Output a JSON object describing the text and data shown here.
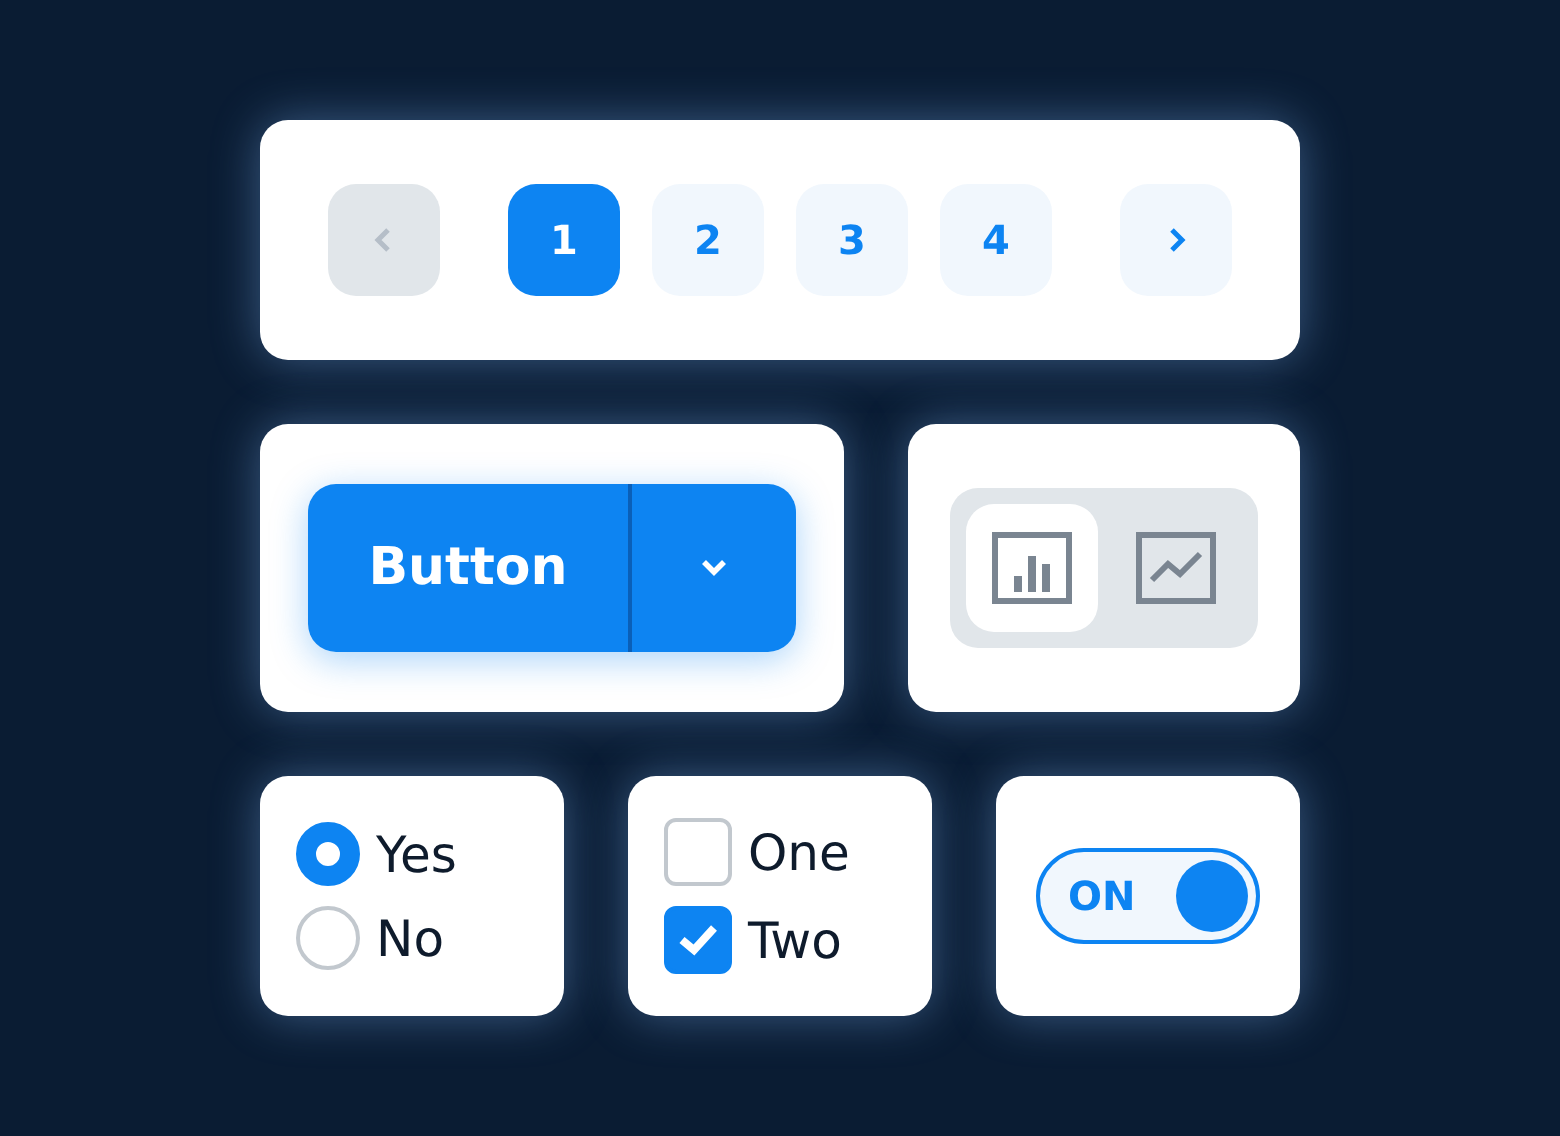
{
  "pagination": {
    "previous": {
      "disabled": true
    },
    "pages": [
      {
        "label": "1",
        "selected": true
      },
      {
        "label": "2",
        "selected": false
      },
      {
        "label": "3",
        "selected": false
      },
      {
        "label": "4",
        "selected": false
      }
    ],
    "next": {
      "disabled": false
    }
  },
  "split_button": {
    "label": "Button"
  },
  "view_switch": [
    {
      "kind": "bar",
      "selected": true
    },
    {
      "kind": "line",
      "selected": false
    }
  ],
  "radios": [
    {
      "label": "Yes",
      "selected": true
    },
    {
      "label": "No",
      "selected": false
    }
  ],
  "checkboxes": [
    {
      "label": "One",
      "checked": false
    },
    {
      "label": "Two",
      "checked": true
    }
  ],
  "toggle": {
    "label": "ON",
    "on": true
  }
}
